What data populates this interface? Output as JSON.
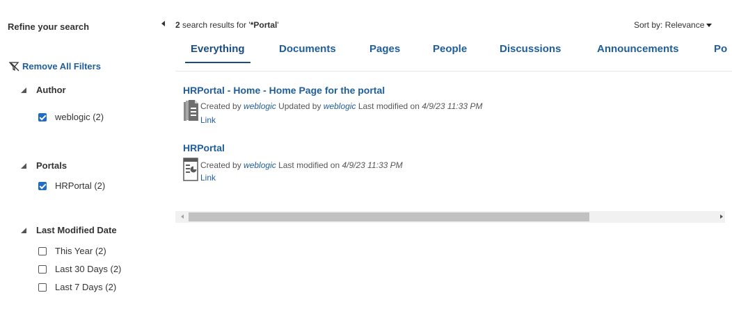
{
  "refine": {
    "title": "Refine your search",
    "remove_all": "Remove All Filters",
    "groups": [
      {
        "label": "Author",
        "facets": [
          {
            "label": "weblogic (2)",
            "checked": true
          }
        ]
      },
      {
        "label": "Portals",
        "facets": [
          {
            "label": "HRPortal (2)",
            "checked": true
          }
        ]
      },
      {
        "label": "Last Modified Date",
        "facets": [
          {
            "label": "This Year (2)",
            "checked": false
          },
          {
            "label": "Last 30 Days (2)",
            "checked": false
          },
          {
            "label": "Last 7 Days (2)",
            "checked": false
          }
        ]
      }
    ]
  },
  "summary": {
    "count": "2",
    "text": " search results for '",
    "query": "*Portal",
    "close": "'"
  },
  "sort": {
    "label": "Sort by: Relevance"
  },
  "tabs": [
    "Everything",
    "Documents",
    "Pages",
    "People",
    "Discussions",
    "Announcements",
    "Po"
  ],
  "results": [
    {
      "title": "HRPortal - Home - Home Page for the portal",
      "icon": "pages-icon",
      "created_prefix": "Created by ",
      "created_by": "weblogic",
      "updated_prefix": " Updated by ",
      "updated_by": "weblogic",
      "modified_prefix": " Last modified on ",
      "modified_on": "4/9/23 11:33 PM",
      "link": "Link"
    },
    {
      "title": "HRPortal",
      "icon": "portal-icon",
      "created_prefix": "Created by ",
      "created_by": "weblogic",
      "modified_prefix": " Last modified on ",
      "modified_on": "4/9/23 11:33 PM",
      "link": "Link"
    }
  ],
  "colors": {
    "link": "#1f5d9b",
    "checkbox": "#1e6cc8"
  }
}
